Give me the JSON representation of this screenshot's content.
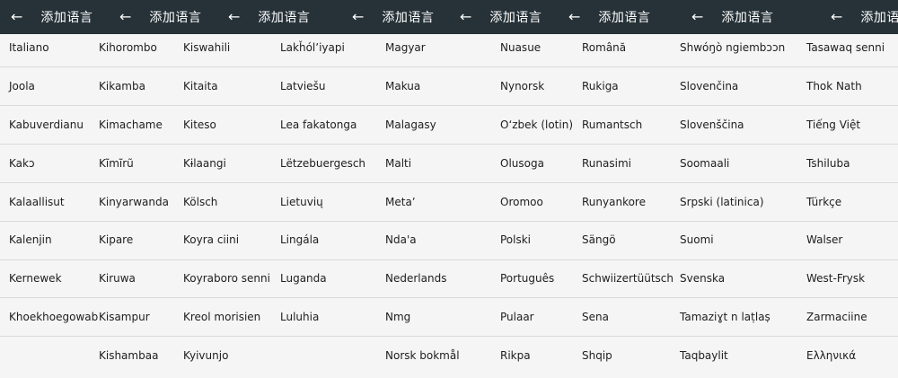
{
  "header": {
    "title": "添加语言",
    "back_icon": "arrow-left-icon"
  },
  "columns": [
    [
      "Italiano",
      "Joola",
      "Kabuverdianu",
      "Kakɔ",
      "Kalaallisut",
      "Kalenjin",
      "Kernewek",
      "Khoekhoegowab",
      ""
    ],
    [
      "Kihorombo",
      "Kikamba",
      "Kimachame",
      "Kĩmĩrũ",
      "Kinyarwanda",
      "Kipare",
      "Kiruwa",
      "Kisampur",
      "Kishambaa"
    ],
    [
      "Kiswahili",
      "Kitaita",
      "Kiteso",
      "Kɨlaangi",
      "Kölsch",
      "Koyra ciini",
      "Koyraboro senni",
      "Kreol morisien",
      "Kyivunjo"
    ],
    [
      "Lakȟólʼiyapi",
      "Latviešu",
      "Lea fakatonga",
      "Lëtzebuergesch",
      "Lietuvių",
      "Lingála",
      "Luganda",
      "Luluhia",
      ""
    ],
    [
      "Magyar",
      "Makua",
      "Malagasy",
      "Malti",
      "Metaʼ",
      "Ndaꞌa",
      "Nederlands",
      "Nmg",
      "Norsk bokmål"
    ],
    [
      "Nuasue",
      "Nynorsk",
      "O‘zbek (lotin)",
      "Olusoga",
      "Oromoo",
      "Polski",
      "Português",
      "Pulaar",
      "Rikpa"
    ],
    [
      "Română",
      "Rukiga",
      "Rumantsch",
      "Runasimi",
      "Runyankore",
      "Sängö",
      "Schwiizertüütsch",
      "Sena",
      "Shqip"
    ],
    [
      "Shwóŋò ngiembɔɔn",
      "Slovenčina",
      "Slovenščina",
      "Soomaali",
      "Srpski (latinica)",
      "Suomi",
      "Svenska",
      "Tamaziɣt n laṭlaṣ",
      "Taqbaylit"
    ],
    [
      "Tasawaq senni",
      "Thok Nath",
      "Tiếng Việt",
      "Tshiluba",
      "Türkçe",
      "Walser",
      "West-Frysk",
      "Zarmaciine",
      "Ελληνικά"
    ]
  ]
}
